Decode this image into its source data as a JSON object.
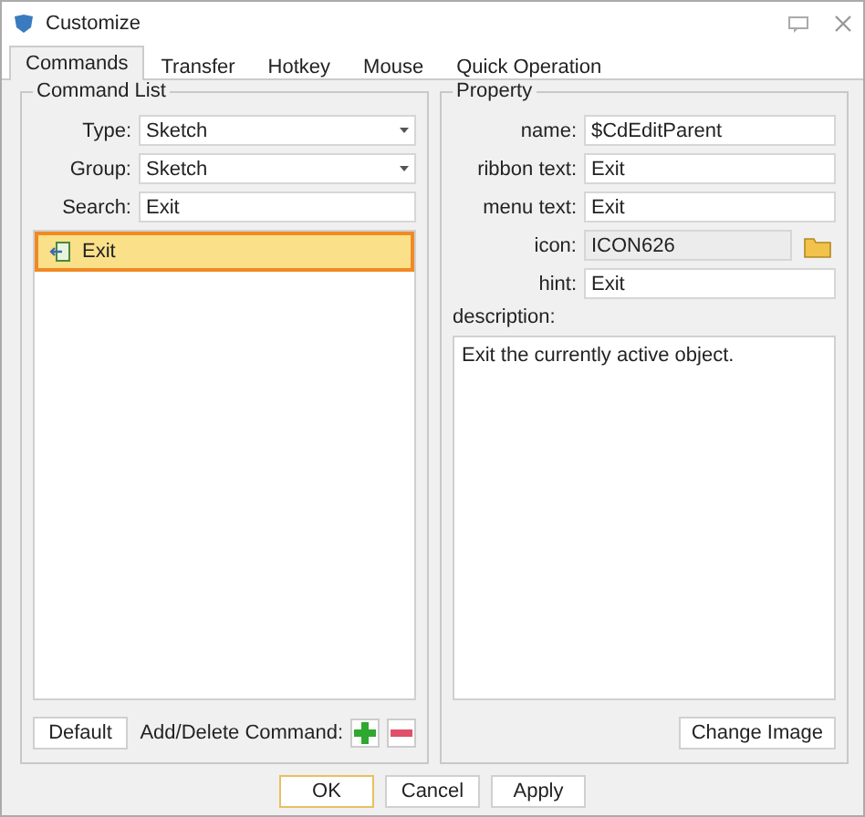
{
  "window": {
    "title": "Customize"
  },
  "tabs": [
    {
      "label": "Commands",
      "selected": true
    },
    {
      "label": "Transfer",
      "selected": false
    },
    {
      "label": "Hotkey",
      "selected": false
    },
    {
      "label": "Mouse",
      "selected": false
    },
    {
      "label": "Quick Operation",
      "selected": false
    }
  ],
  "command_list": {
    "legend": "Command List",
    "filters": [
      {
        "label": "Type:",
        "kind": "dropdown",
        "value": "Sketch"
      },
      {
        "label": "Group:",
        "kind": "dropdown",
        "value": "Sketch"
      },
      {
        "label": "Search:",
        "kind": "text",
        "value": "Exit"
      }
    ],
    "items": [
      {
        "label": "Exit",
        "selected": true
      }
    ],
    "default_button": "Default",
    "add_delete_label": "Add/Delete Command:"
  },
  "property": {
    "legend": "Property",
    "fields": [
      {
        "label": "name:",
        "value": "$CdEditParent",
        "disabled": false,
        "kind": "text"
      },
      {
        "label": "ribbon text:",
        "value": "Exit",
        "disabled": false,
        "kind": "text"
      },
      {
        "label": "menu text:",
        "value": "Exit",
        "disabled": false,
        "kind": "text"
      },
      {
        "label": "icon:",
        "value": "ICON626",
        "disabled": true,
        "kind": "browse"
      },
      {
        "label": "hint:",
        "value": "Exit",
        "disabled": false,
        "kind": "text"
      }
    ],
    "description_label": "description:",
    "description": "Exit the currently active object.",
    "change_image_button": "Change Image"
  },
  "buttons": [
    {
      "label": "OK",
      "default": true
    },
    {
      "label": "Cancel",
      "default": false
    },
    {
      "label": "Apply",
      "default": false
    }
  ]
}
